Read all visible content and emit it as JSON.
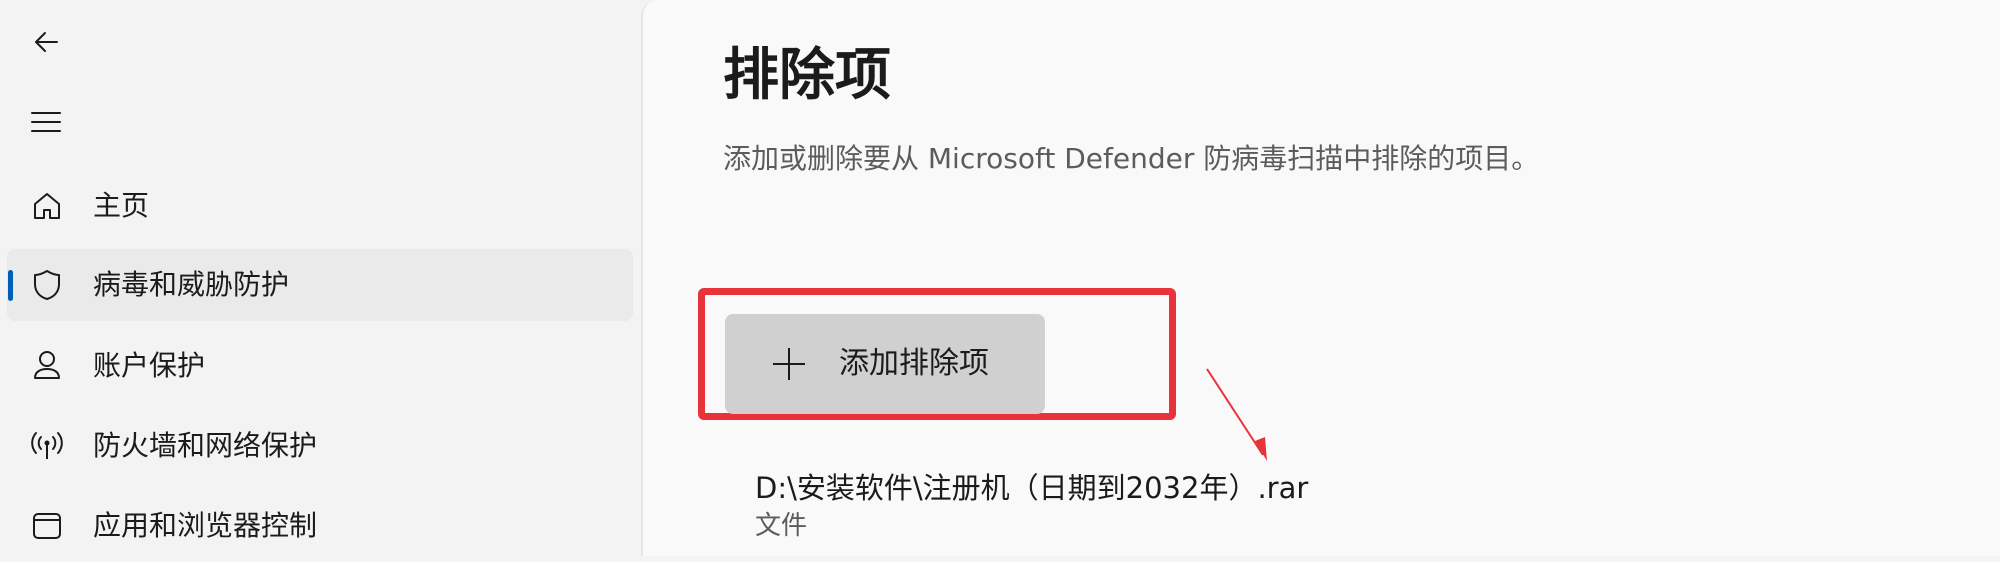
{
  "sidebar": {
    "back_icon": "back-arrow-icon",
    "menu_icon": "hamburger-menu-icon",
    "items": [
      {
        "label": "主页",
        "icon": "home-icon",
        "selected": false
      },
      {
        "label": "病毒和威胁防护",
        "icon": "shield-icon",
        "selected": true
      },
      {
        "label": "账户保护",
        "icon": "person-icon",
        "selected": false
      },
      {
        "label": "防火墙和网络保护",
        "icon": "wifi-antenna-icon",
        "selected": false
      },
      {
        "label": "应用和浏览器控制",
        "icon": "browser-window-icon",
        "selected": false
      }
    ]
  },
  "main": {
    "title": "排除项",
    "description": "添加或删除要从 Microsoft Defender 防病毒扫描中排除的项目。",
    "add_button": {
      "label": "添加排除项",
      "icon": "plus-icon"
    },
    "exclusions": [
      {
        "path": "D:\\安装软件\\注册机（日期到2032年）.rar",
        "type": "文件"
      }
    ]
  },
  "colors": {
    "accent": "#005fb8",
    "highlight": "#e8333b",
    "button_bg": "#d0d0d0"
  }
}
